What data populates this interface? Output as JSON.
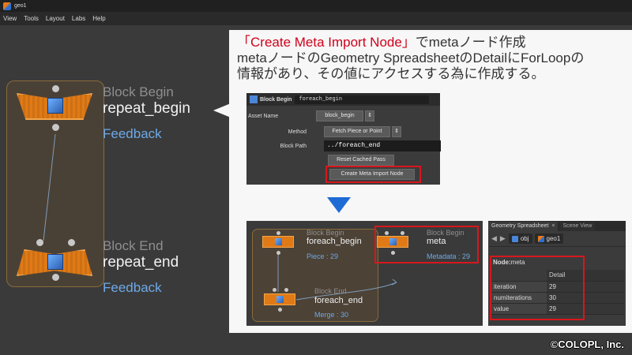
{
  "window": {
    "title": "geo1"
  },
  "menu": [
    "View",
    "Tools",
    "Layout",
    "Labs",
    "Help"
  ],
  "network": {
    "begin": {
      "type": "Block Begin",
      "name": "repeat_begin",
      "info": "Feedback"
    },
    "end": {
      "type": "Block End",
      "name": "repeat_end",
      "info": "Feedback"
    }
  },
  "callout": {
    "line1_highlight": "「Create Meta Import Node」",
    "line1_rest": "でmetaノード作成",
    "line2": "metaノードのGeometry SpreadsheetのDetailにForLoopの",
    "line3": "情報があり、その値にアクセスする為に作成する。"
  },
  "param_panel": {
    "type_label": "Block Begin",
    "node_name": "foreach_begin",
    "asset_name_label": "Asset Name",
    "asset_name_value": "block_begin",
    "method_label": "Method",
    "method_value": "Fetch Piece or Point",
    "block_path_label": "Block Path",
    "block_path_value": "../foreach_end",
    "reset_button": "Reset Cached Pass",
    "create_meta_button": "Create Meta Import Node"
  },
  "small_network": {
    "begin": {
      "type": "Block Begin",
      "name": "foreach_begin",
      "info": "Piece : 29"
    },
    "meta": {
      "type": "Block Begin",
      "name": "meta",
      "info": "Metadata : 29"
    },
    "end": {
      "type": "Block End",
      "name": "foreach_end",
      "info": "Merge : 30"
    }
  },
  "spreadsheet": {
    "tabs": [
      "Geometry Spreadsheet",
      "Scene View"
    ],
    "path": [
      "obj",
      "geo1"
    ],
    "node_label": "Node:",
    "node_value": "meta",
    "column_header": "Detail",
    "rows": [
      {
        "key": "iteration",
        "value": "29"
      },
      {
        "key": "numiterations",
        "value": "30"
      },
      {
        "key": "value",
        "value": "29"
      }
    ]
  },
  "watermark": "©COLOPL, Inc.",
  "colors": {
    "accent_red": "#d8161d",
    "node_orange": "#e07a16",
    "info_blue": "#6fa9e6",
    "arrow_blue": "#1f6bd6"
  }
}
